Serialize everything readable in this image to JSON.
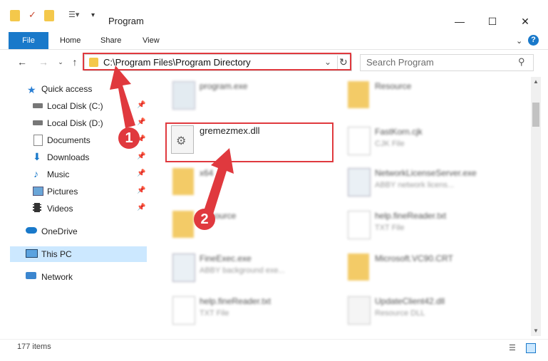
{
  "window": {
    "title": "Program"
  },
  "ribbon": {
    "tabs": [
      "File",
      "Home",
      "Share",
      "View"
    ]
  },
  "address": {
    "path": "C:\\Program Files\\Program Directory"
  },
  "search": {
    "placeholder": "Search Program"
  },
  "sidebar": {
    "items": [
      {
        "label": "Quick access",
        "icon": "star-icon"
      },
      {
        "label": "Local Disk (C:)",
        "icon": "drive-icon",
        "pinned": true
      },
      {
        "label": "Local Disk (D:)",
        "icon": "drive-icon",
        "pinned": true
      },
      {
        "label": "Documents",
        "icon": "documents-icon",
        "pinned": true
      },
      {
        "label": "Downloads",
        "icon": "downloads-icon",
        "pinned": true
      },
      {
        "label": "Music",
        "icon": "music-icon",
        "pinned": true
      },
      {
        "label": "Pictures",
        "icon": "pictures-icon",
        "pinned": true
      },
      {
        "label": "Videos",
        "icon": "videos-icon",
        "pinned": true
      },
      {
        "label": "OneDrive",
        "icon": "cloud-icon"
      },
      {
        "label": "This PC",
        "icon": "pc-icon",
        "selected": true
      },
      {
        "label": "Network",
        "icon": "network-icon"
      }
    ]
  },
  "files": [
    {
      "name": "program.exe",
      "sub": "",
      "icon": "exe-icon",
      "blur": true
    },
    {
      "name": "Resource",
      "sub": "",
      "icon": "folder-icon",
      "blur": true
    },
    {
      "name": "gremezmex.dll",
      "sub": "",
      "icon": "dll-icon",
      "blur": false
    },
    {
      "name": "FastKorn.cjk",
      "sub": "CJK File",
      "icon": "file-icon",
      "blur": true
    },
    {
      "name": "x64",
      "sub": "",
      "icon": "folder-icon",
      "blur": true
    },
    {
      "name": "NetworkLicenseServer.exe",
      "sub": "ABBY network licens...",
      "icon": "exe-icon",
      "blur": true
    },
    {
      "name": "Resource",
      "sub": "",
      "icon": "folder-icon",
      "blur": true
    },
    {
      "name": "help.fineReader.txt",
      "sub": "TXT File",
      "icon": "file-icon",
      "blur": true
    },
    {
      "name": "FineExec.exe",
      "sub": "ABBY background exe...",
      "icon": "exe-icon",
      "blur": true
    },
    {
      "name": "Microsoft.VC90.CRT",
      "sub": "",
      "icon": "folder-icon",
      "blur": true
    },
    {
      "name": "help.fineReader.txt",
      "sub": "TXT File",
      "icon": "file-icon",
      "blur": true
    },
    {
      "name": "UpdateClient42.dll",
      "sub": "Resource DLL",
      "icon": "dll-icon",
      "blur": true
    }
  ],
  "callouts": [
    "1",
    "2"
  ],
  "status": {
    "count": "177 items"
  },
  "colors": {
    "accent": "#1979ca",
    "highlight": "#e0393e",
    "selected": "#cce8ff"
  }
}
